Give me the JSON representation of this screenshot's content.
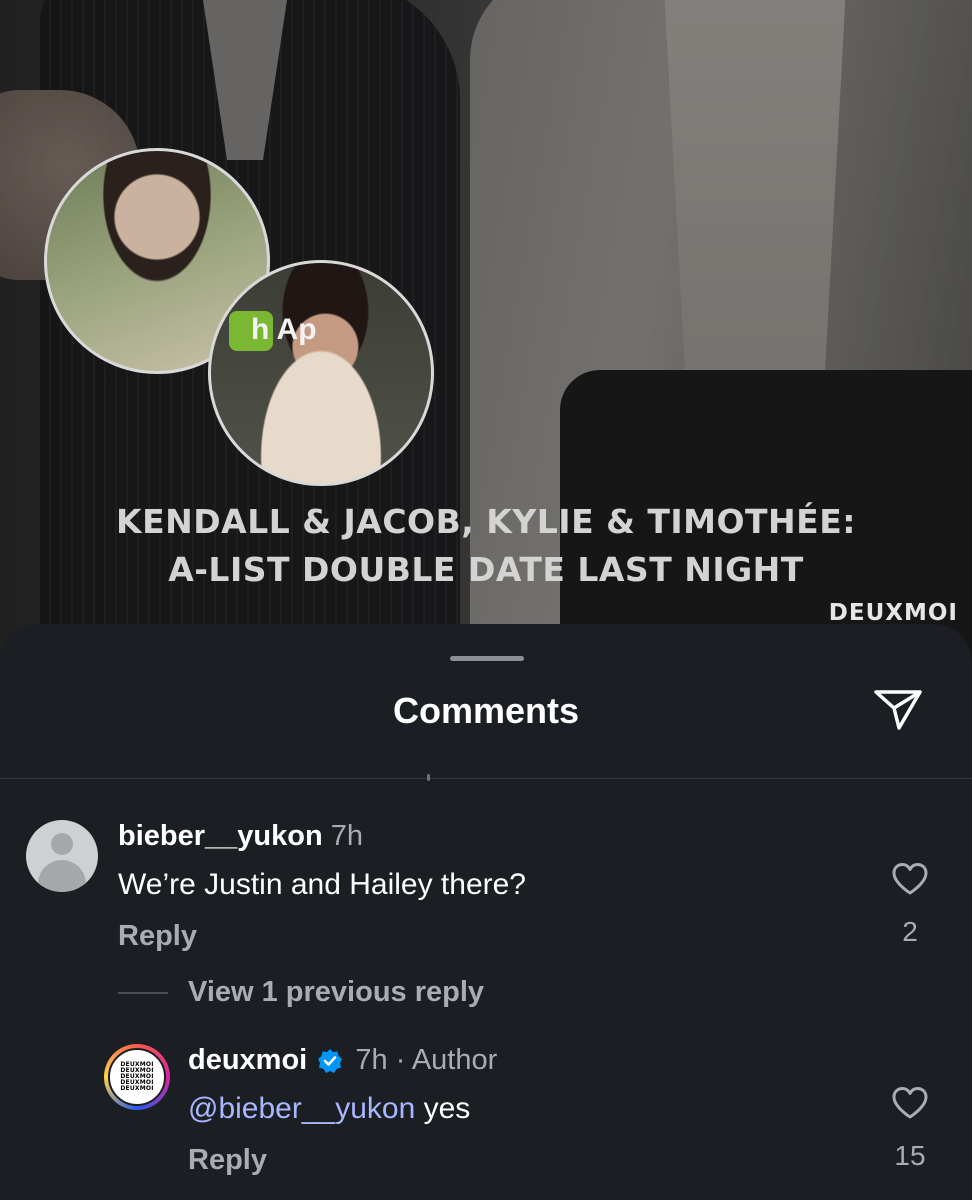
{
  "post": {
    "headline_line1": "KENDALL & JACOB, KYLIE & TIMOTHÉE:",
    "headline_line2": "A-LIST DOUBLE DATE LAST NIGHT",
    "watermark": "DEUXMOI",
    "sign_text": "h Ap"
  },
  "sheet": {
    "title": "Comments"
  },
  "comments": [
    {
      "username": "bieber__yukon",
      "time": "7h",
      "text": "We’re Justin and Hailey there?",
      "reply_label": "Reply",
      "likes": "2"
    }
  ],
  "view_replies": "View 1 previous reply",
  "replies": [
    {
      "username": "deuxmoi",
      "time": "7h",
      "author_tag": "· Author",
      "mention": "@bieber__yukon",
      "text": "yes",
      "reply_label": "Reply",
      "likes": "15",
      "avatar_lines": [
        "DEUXMOI",
        "DEUXMOI",
        "DEUXMOI",
        "DEUXMOI",
        "DEUXMOI"
      ]
    }
  ],
  "colors": {
    "sheet_bg": "#1b1e22",
    "mention": "#a9b7ff",
    "verified": "#0095f6",
    "muted_text": "#a9adb2"
  },
  "icons": [
    "share-icon",
    "heart-icon",
    "verified-badge-icon",
    "default-avatar-icon"
  ]
}
